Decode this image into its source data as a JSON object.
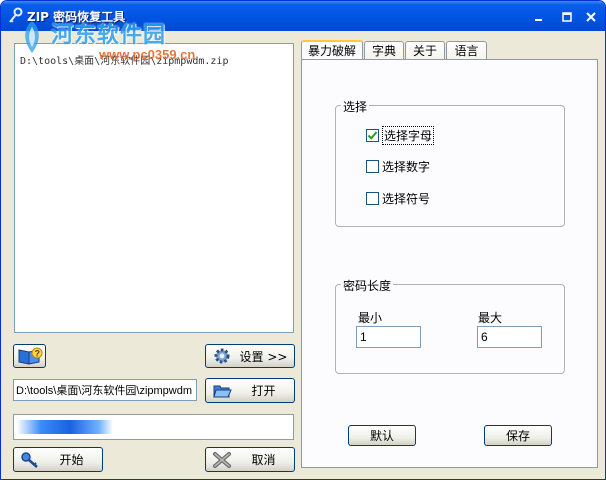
{
  "window": {
    "title": "ZIP 密码恢复工具",
    "accent": "#0054e3"
  },
  "watermark": {
    "text": "河东软件园",
    "url": "www.pc0359.cn"
  },
  "file_list": {
    "items": [
      "D:\\tools\\桌面\\河东软件园\\zipmpwdm.zip"
    ]
  },
  "buttons": {
    "settings": "设置 >>",
    "open": "打开",
    "start": "开始",
    "cancel": "取消",
    "default": "默认",
    "save": "保存"
  },
  "path_input": {
    "value": "D:\\tools\\桌面\\河东软件园\\zipmpwdm"
  },
  "progress": {
    "fraction": 0.35
  },
  "tabs": [
    "暴力破解",
    "字典",
    "关于",
    "语言"
  ],
  "active_tab": 0,
  "select_group": {
    "title": "选择",
    "options": [
      {
        "label": "选择字母",
        "checked": true
      },
      {
        "label": "选择数字",
        "checked": false
      },
      {
        "label": "选择符号",
        "checked": false
      }
    ]
  },
  "length_group": {
    "title": "密码长度",
    "min_label": "最小",
    "min_value": "1",
    "max_label": "最大",
    "max_value": "6"
  },
  "icons": {
    "title": "key-icon",
    "help": "book-help-icon",
    "settings": "gear-icon",
    "open": "folder-open-icon",
    "start": "key-icon",
    "cancel": "cross-icon"
  }
}
